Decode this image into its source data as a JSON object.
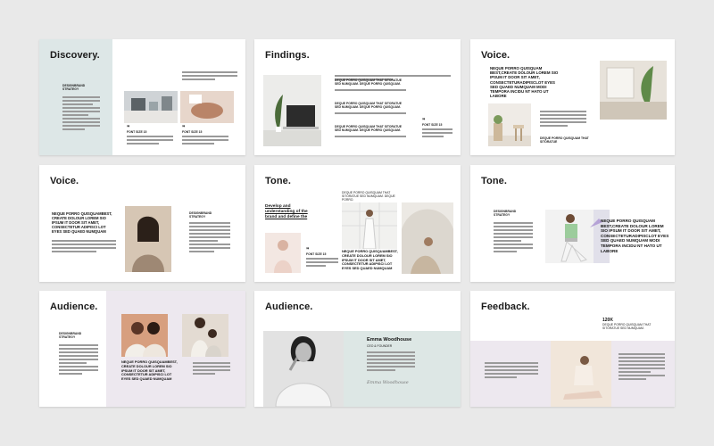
{
  "slides": [
    {
      "title": "Discovery.",
      "label": "DESIGNBRAND STRATEGY",
      "caption": "FONT SIZE 15"
    },
    {
      "title": "Findings.",
      "heads": [
        "DEQUE PORRO QUISQUAM THAT SITORATUE SED NUMQUAM. DEQUE PORRO QUISQUAM.",
        "DEQUE PORRO QUISQUAM THAT SITORATUE SED NUMQUAM. DEQUE PORRO QUISQUAM.",
        "DEQUE PORRO QUISQUAM THAT SITORATUE SED NUMQUAM. DEQUE PORRO QUISQUAM."
      ],
      "caption": "FONT SIZE 15"
    },
    {
      "title": "Voice.",
      "head": "NEQUE PORRO QUISQUAM BEST,CREATE DOLOUR LOREM SIO IPSUM IT DOOR SIT AMET, CONSECTETURADIPISCLOT EYES SED QUAED NUMQUAM MODI TEMPORA INCIDU NT HATO UT LABORE",
      "small": "DEQUE PORRO QUISQUAM THAT SITORATUE"
    },
    {
      "title": "Voice.",
      "head": "NEQUE PORRO QUISQUAMBEST, CREATE DOLOUR LOREM SIO IPSUM IT DOOR SIT AMET, CONSECTETUR ADIPISCI LOT EYES SED QUAED NUMQUAM",
      "label": "DESIGNBRAND STRATEGY"
    },
    {
      "title": "Tone.",
      "ul": "Develop and understanding of the brand and define the",
      "top": "DEQUE PORRO QUISQUAM THAT SITORATUE SED NUMQUAM. DEQUE PORRO.",
      "caption": "FONT SIZE 15",
      "head": "NEQUE PORRO QUISQUAMBEST, CREATE DOLOUR LOREM SIO IPSUM IT DOOR SIT AMET, CONSECTETUR ADIPISCI LOT EYES SED QUAED NUMQUAM"
    },
    {
      "title": "Tone.",
      "label": "DESIGNBRAND STRATEGY",
      "head": "NEQUE PORRO QUISQUAM BEST,CREATE DOLOUR LOREM SIO IPSUM IT DOOR SIT AMET, CONSECTETURADIPISCLOT EYES SED QUAED NUMQUAM MODI TEMPORA INCIDU NT HATO UT LABORE"
    },
    {
      "title": "Audience.",
      "label": "DESIGNBRAND STRATEGY",
      "head": "NEQUE PORRO QUISQUAMBEST, CREATE DOLOUR LOREM SIO IPSUM IT DOOR SIT AMET, CONSECTETUR ADIPISCI LOT EYES SED QUAED NUMQUAM"
    },
    {
      "title": "Audience.",
      "name": "Emma Woodhouse",
      "role": "CEO & FOUNDER",
      "signature": "Emma Woodhouse"
    },
    {
      "title": "Feedback.",
      "stat": "120K",
      "sub": "DEQUE PORRO QUISQUAM THAT SITORATUE SED NUMQUAM."
    }
  ]
}
